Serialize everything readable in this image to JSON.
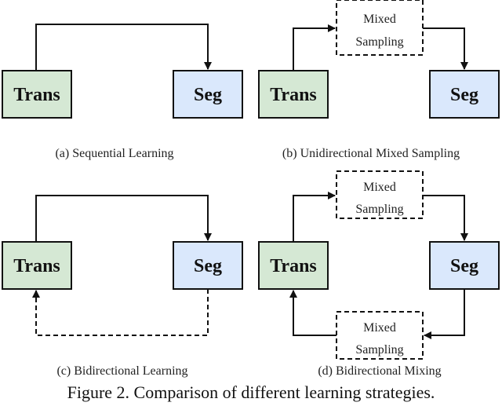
{
  "figure": {
    "caption": "Figure 2. Comparison of different learning strategies.",
    "colors": {
      "trans_fill": "#d5e8d4",
      "seg_fill": "#dae8fc",
      "stroke": "#111111"
    },
    "panels": [
      {
        "id": "a",
        "caption": "(a) Sequential Learning",
        "trans_label": "Trans",
        "seg_label": "Seg"
      },
      {
        "id": "b",
        "caption": "(b) Unidirectional Mixed Sampling",
        "trans_label": "Trans",
        "seg_label": "Seg",
        "mix_top": [
          "Mixed",
          "Sampling"
        ]
      },
      {
        "id": "c",
        "caption": "(c) Bidirectional Learning",
        "trans_label": "Trans",
        "seg_label": "Seg"
      },
      {
        "id": "d",
        "caption": "(d) Bidirectional Mixing",
        "trans_label": "Trans",
        "seg_label": "Seg",
        "mix_top": [
          "Mixed",
          "Sampling"
        ],
        "mix_bottom": [
          "Mixed",
          "Sampling"
        ]
      }
    ]
  }
}
